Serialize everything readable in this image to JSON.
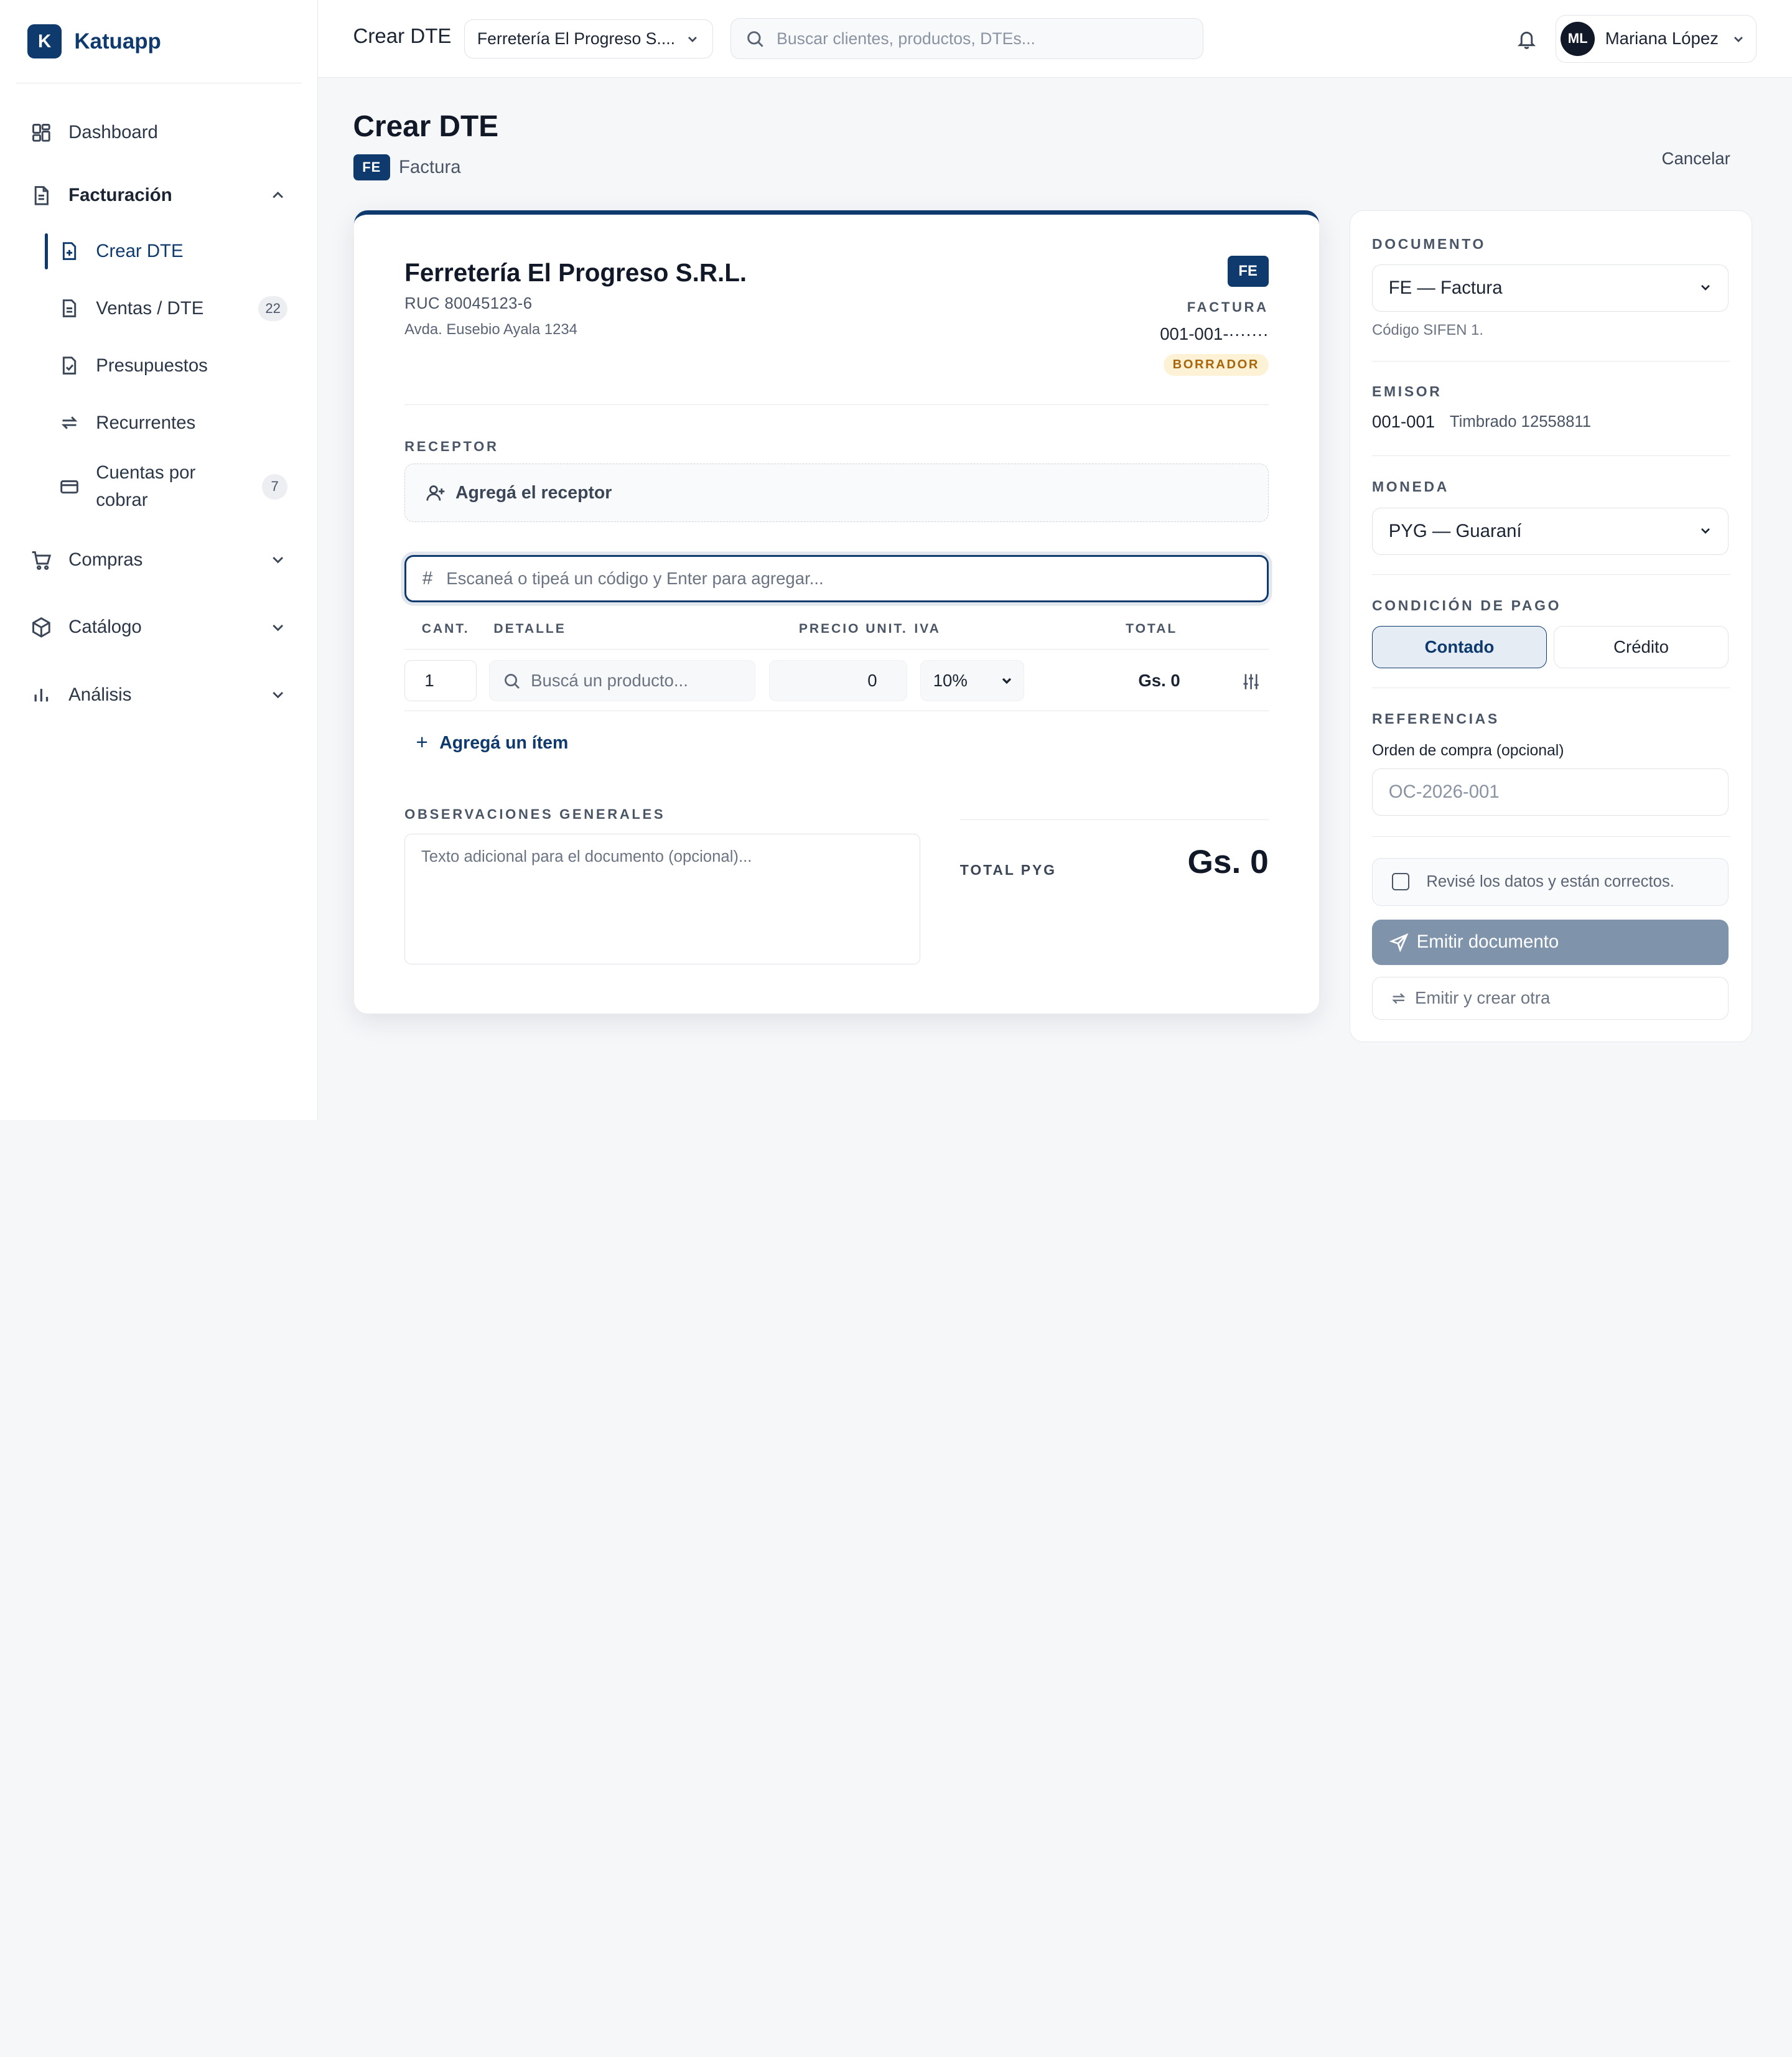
{
  "brand": {
    "logo_letter": "K",
    "name": "Katuapp",
    "color": "#0f3a6e"
  },
  "sidebar": {
    "dashboard": "Dashboard",
    "facturacion": "Facturación",
    "sub": {
      "crear_dte": "Crear DTE",
      "ventas": "Ventas / DTE",
      "ventas_count": "22",
      "presupuestos": "Presupuestos",
      "recurrentes": "Recurrentes",
      "cuentas_line1": "Cuentas por",
      "cuentas_line2": "cobrar",
      "cuentas_count": "7"
    },
    "compras": "Compras",
    "catalogo": "Catálogo",
    "analisis": "Análisis"
  },
  "topbar": {
    "title": "Crear DTE",
    "company": "Ferretería El Progreso S....",
    "search_placeholder": "Buscar clientes, productos, DTEs...",
    "user_initials": "ML",
    "user_name": "Mariana López"
  },
  "page": {
    "title": "Crear DTE",
    "badge": "FE",
    "doc_type": "Factura",
    "cancel": "Cancelar"
  },
  "document": {
    "company": "Ferretería El Progreso S.R.L.",
    "ruc": "RUC 80045123-6",
    "address": "Avda. Eusebio Ayala 1234",
    "badge": "FE",
    "type_label": "FACTURA",
    "number": "001-001-·······",
    "status": "BORRADOR",
    "receptor_label": "RECEPTOR",
    "receptor_btn": "Agregá el receptor",
    "scan_placeholder": "Escaneá o tipeá un código y Enter para agregar...",
    "columns": {
      "qty": "CANT.",
      "detail": "DETALLE",
      "price": "PRECIO UNIT.",
      "iva": "IVA",
      "total": "TOTAL"
    },
    "row": {
      "qty": "1",
      "product_placeholder": "Buscá un producto...",
      "price": "0",
      "iva": "10%",
      "total": "Gs. 0"
    },
    "add_item": "Agregá un ítem",
    "obs_label": "OBSERVACIONES GENERALES",
    "obs_placeholder": "Texto adicional para el documento (opcional)...",
    "total_label": "TOTAL PYG",
    "total_value": "Gs. 0"
  },
  "panel": {
    "documento_label": "DOCUMENTO",
    "documento_value": "FE — Factura",
    "codigo": "Código SIFEN 1.",
    "emisor_label": "EMISOR",
    "emisor_code": "001-001",
    "emisor_timbrado": "Timbrado 12558811",
    "moneda_label": "MONEDA",
    "moneda_value": "PYG — Guaraní",
    "pago_label": "CONDICIÓN DE PAGO",
    "contado": "Contado",
    "credito": "Crédito",
    "ref_label": "REFERENCIAS",
    "oc_label": "Orden de compra (opcional)",
    "oc_placeholder": "OC-2026-001",
    "check_label": "Revisé los datos y están correctos.",
    "emit": "Emitir documento",
    "emit2": "Emitir y crear otra"
  }
}
